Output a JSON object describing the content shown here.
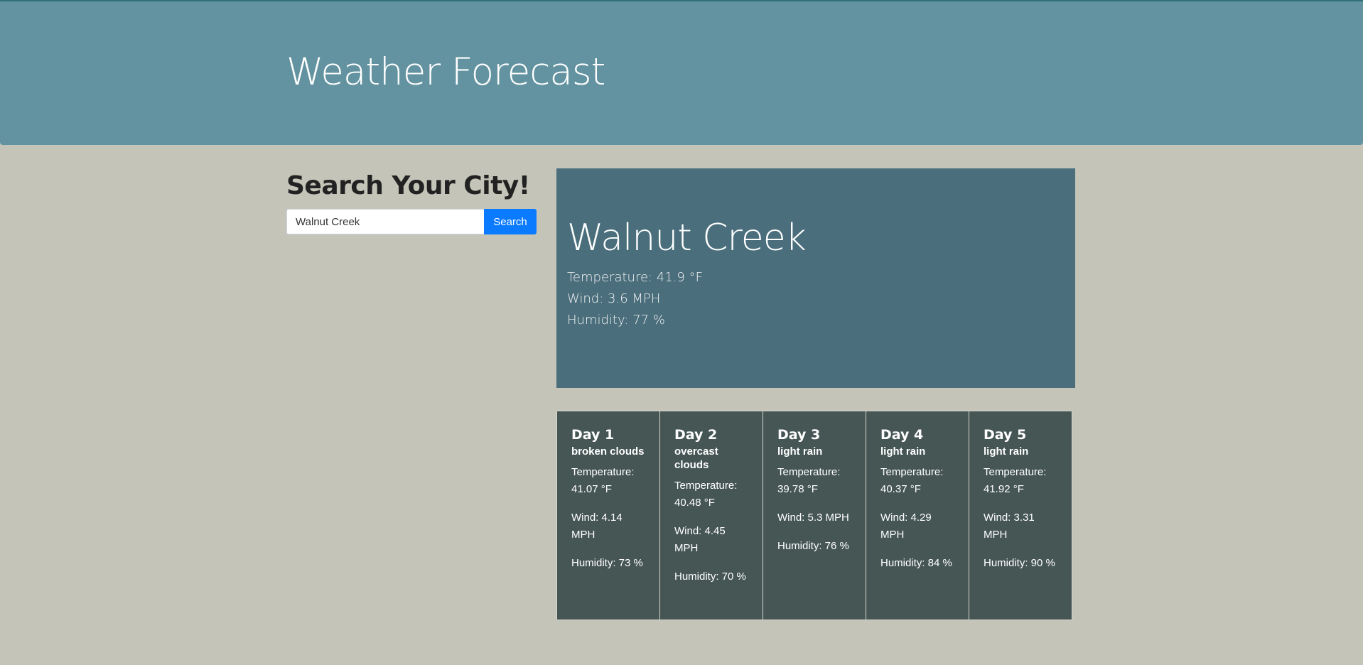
{
  "header": {
    "title": "Weather Forecast"
  },
  "search": {
    "title": "Search Your City!",
    "input_value": "Walnut Creek",
    "button_label": "Search"
  },
  "current": {
    "city": "Walnut Creek",
    "temperature": "Temperature: 41.9 °F",
    "wind": "Wind: 3.6 MPH",
    "humidity": "Humidity: 77 %"
  },
  "forecast": [
    {
      "day": "Day 1",
      "desc": "broken clouds",
      "temperature": "Temperature: 41.07 °F",
      "wind": "Wind: 4.14 MPH",
      "humidity": "Humidity: 73 %"
    },
    {
      "day": "Day 2",
      "desc": "overcast clouds",
      "temperature": "Temperature: 40.48 °F",
      "wind": "Wind: 4.45 MPH",
      "humidity": "Humidity: 70 %"
    },
    {
      "day": "Day 3",
      "desc": "light rain",
      "temperature": "Temperature: 39.78 °F",
      "wind": "Wind: 5.3 MPH",
      "humidity": "Humidity: 76 %"
    },
    {
      "day": "Day 4",
      "desc": "light rain",
      "temperature": "Temperature: 40.37 °F",
      "wind": "Wind: 4.29 MPH",
      "humidity": "Humidity: 84 %"
    },
    {
      "day": "Day 5",
      "desc": "light rain",
      "temperature": "Temperature: 41.92 °F",
      "wind": "Wind: 3.31 MPH",
      "humidity": "Humidity: 90 %"
    }
  ],
  "colors": {
    "page_background": "#c4c4b8",
    "header_background": "#6393a0",
    "current_panel": "#4a6e7c",
    "forecast_card": "#465655",
    "search_button": "#0a7bff"
  }
}
